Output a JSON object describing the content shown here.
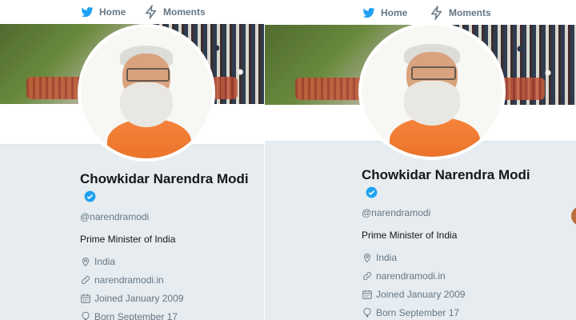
{
  "nav": {
    "home": "Home",
    "moments": "Moments"
  },
  "profile": {
    "name": "Chowkidar Narendra Modi",
    "handle": "@narendramodi",
    "bio": "Prime Minister of India",
    "location": "India",
    "website": "narendramodi.in",
    "joined": "Joined January 2009",
    "born": "Born September 17"
  },
  "icons": {
    "home": "twitter-bird-icon",
    "moments": "lightning-icon",
    "verified": "verified-badge-icon",
    "location": "location-pin-icon",
    "website": "link-icon",
    "joined": "calendar-icon",
    "born": "balloon-icon"
  },
  "colors": {
    "brand": "#1da1f2",
    "background": "#e6ecf0",
    "text": "#14171a",
    "muted": "#657786"
  }
}
